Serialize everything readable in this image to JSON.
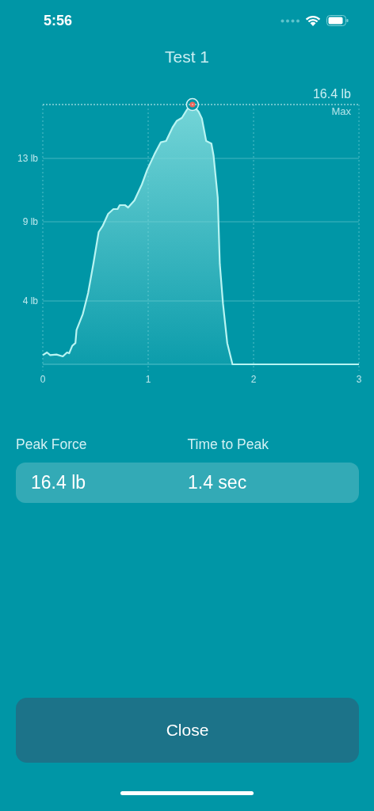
{
  "status_bar": {
    "time": "5:56"
  },
  "title": "Test 1",
  "chart": {
    "chart_data": {
      "type": "area",
      "x": [
        0,
        0.04,
        0.07,
        0.13,
        0.19,
        0.23,
        0.25,
        0.28,
        0.31,
        0.32,
        0.38,
        0.43,
        0.48,
        0.53,
        0.57,
        0.62,
        0.67,
        0.71,
        0.73,
        0.78,
        0.81,
        0.87,
        0.94,
        0.99,
        1.06,
        1.12,
        1.17,
        1.23,
        1.27,
        1.32,
        1.37,
        1.42,
        1.48,
        1.51,
        1.55,
        1.6,
        1.62,
        1.66,
        1.68,
        1.71,
        1.75,
        1.8,
        3
      ],
      "series": [
        {
          "color": "#b8f4f2",
          "values": [
            0.58,
            0.75,
            0.58,
            0.62,
            0.5,
            0.75,
            0.7,
            1.17,
            1.34,
            2.17,
            3.17,
            4.5,
            6.34,
            8.35,
            8.76,
            9.5,
            9.8,
            9.8,
            10.05,
            10.05,
            9.9,
            10.35,
            11.35,
            12.27,
            13.27,
            14.02,
            14.1,
            14.94,
            15.36,
            15.56,
            16.1,
            16.4,
            15.94,
            15.52,
            14.1,
            13.94,
            13.19,
            10.52,
            6.34,
            3.84,
            1.34,
            0,
            0
          ]
        }
      ],
      "xlim": [
        0,
        3
      ],
      "ylim": [
        0,
        16.4
      ],
      "xticks": [
        0,
        1,
        2,
        3
      ],
      "yticks": [
        {
          "value": 4,
          "label": "4 lb"
        },
        {
          "value": 9,
          "label": "9 lb"
        },
        {
          "value": 13,
          "label": "13 lb"
        }
      ],
      "grid": true,
      "annotations": [
        "16.4 lb",
        "Max"
      ]
    }
  },
  "stats": [
    {
      "label": "Peak Force",
      "value": "16.4 lb"
    },
    {
      "label": "Time to Peak",
      "value": "1.4 sec"
    }
  ],
  "buttons": [
    {
      "label": "Close"
    }
  ]
}
